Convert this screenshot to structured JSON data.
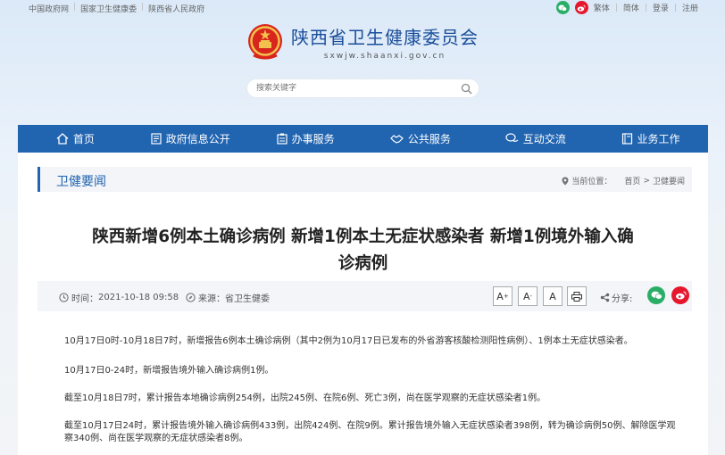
{
  "topbar": {
    "links": [
      "中国政府网",
      "国家卫生健康委",
      "陕西省人民政府"
    ],
    "right": [
      "繁体",
      "简体",
      "登录",
      "注册"
    ]
  },
  "header": {
    "site_name": "陕西省卫生健康委员会",
    "site_url": "sxwjw.shaanxi.gov.cn"
  },
  "search": {
    "placeholder": "搜索关键字"
  },
  "nav": {
    "items": [
      {
        "label": "首页",
        "icon": "home-icon"
      },
      {
        "label": "政府信息公开",
        "icon": "document-icon"
      },
      {
        "label": "办事服务",
        "icon": "clipboard-icon"
      },
      {
        "label": "公共服务",
        "icon": "handshake-icon"
      },
      {
        "label": "互动交流",
        "icon": "chat-icon"
      },
      {
        "label": "业务工作",
        "icon": "book-icon"
      }
    ]
  },
  "section": {
    "title": "卫健要闻",
    "location_label": "当前位置：",
    "breadcrumb_home": "首页",
    "breadcrumb_sep": ">",
    "breadcrumb_current": "卫健要闻"
  },
  "article": {
    "title_line1": "陕西新增6例本土确诊病例 新增1例本土无症状感染者 新增1例境外输入确",
    "title_line2": "诊病例",
    "time_label": "时间：",
    "time_value": "2021-10-18 09:58",
    "source_label": "来源：",
    "source_value": "省卫生健委",
    "font_large": "A",
    "font_large_sup": "+",
    "font_small": "A",
    "font_small_sup": "-",
    "font_default": "A",
    "share_label": "分享:",
    "paragraphs": [
      "10月17日0时-10月18日7时，新增报告6例本土确诊病例（其中2例为10月17日已发布的外省游客核酸检测阳性病例）、1例本土无症状感染者。",
      "10月17日0-24时，新增报告境外输入确诊病例1例。",
      "截至10月18日7时，累计报告本地确诊病例254例，出院245例、在院6例、死亡3例，尚在医学观察的无症状感染者1例。",
      "截至10月17日24时，累计报告境外输入确诊病例433例，出院424例、在院9例。累计报告境外输入无症状感染者398例，转为确诊病例50例、解除医学观察340例、尚在医学观察的无症状感染者8例。"
    ]
  },
  "colors": {
    "brand_blue": "#2164b0",
    "wechat_green": "#2aae67",
    "weibo_red": "#e6162d"
  }
}
